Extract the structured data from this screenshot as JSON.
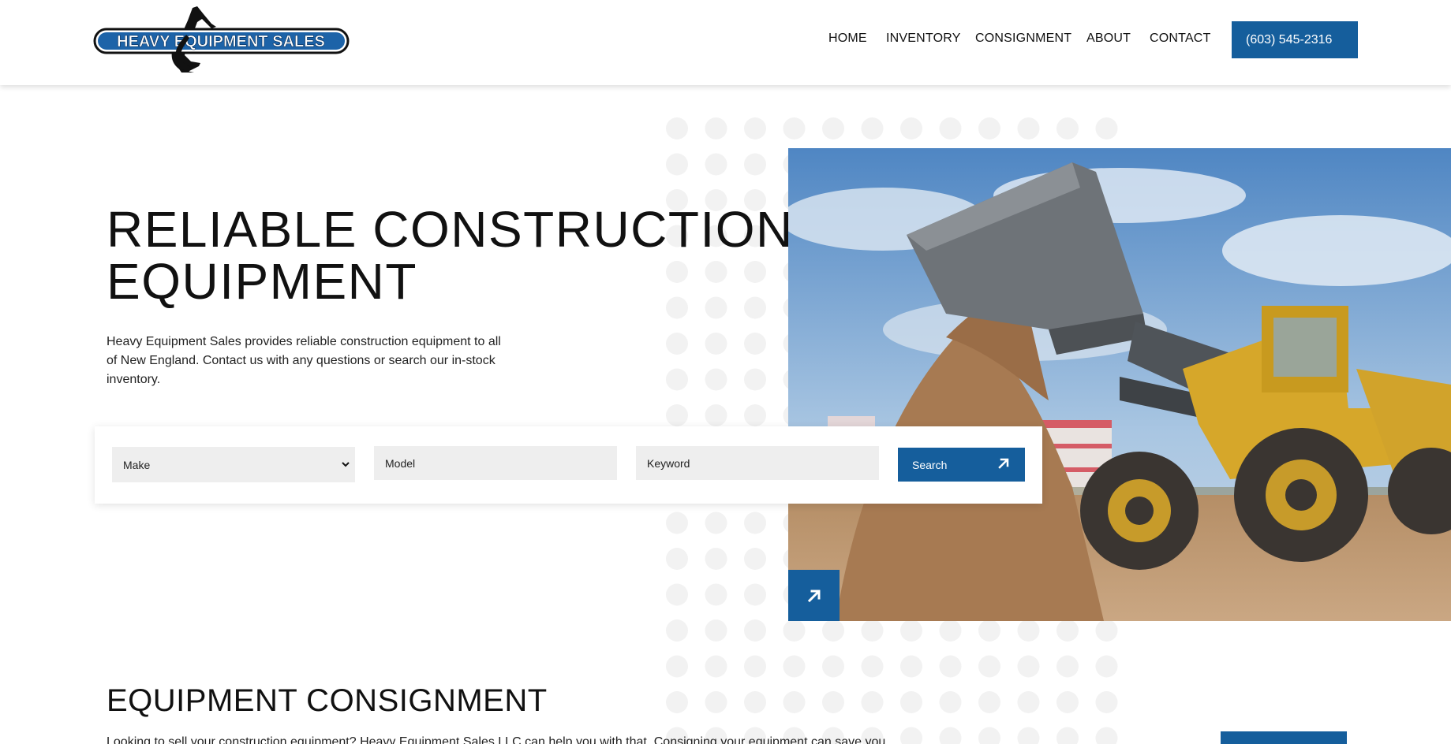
{
  "header": {
    "logo_text": "HEAVY EQUIPMENT SALES",
    "nav": [
      {
        "label": "HOME"
      },
      {
        "label": "INVENTORY"
      },
      {
        "label": "CONSIGNMENT"
      },
      {
        "label": "ABOUT"
      },
      {
        "label": "CONTACT"
      }
    ],
    "phone": "(603) 545-2316"
  },
  "hero": {
    "title_line1": "RELIABLE CONSTRUCTION",
    "title_line2": "EQUIPMENT",
    "description": "Heavy Equipment Sales provides reliable construction equipment to all of New England. Contact us with any questions or search our in-stock inventory.",
    "arrow_icon": "arrow-up-right-icon"
  },
  "search": {
    "make_value": "Make",
    "model_placeholder": "Model",
    "keyword_placeholder": "Keyword",
    "button_label": "Search"
  },
  "consignment": {
    "title": "EQUIPMENT CONSIGNMENT",
    "text": "Looking to sell your construction equipment? Heavy Equipment Sales LLC can help you with that. Consigning your equipment can save you"
  },
  "colors": {
    "brand_blue": "#155e9c",
    "dot_gray": "#f2f2f2",
    "field_gray": "#eeeeee"
  }
}
